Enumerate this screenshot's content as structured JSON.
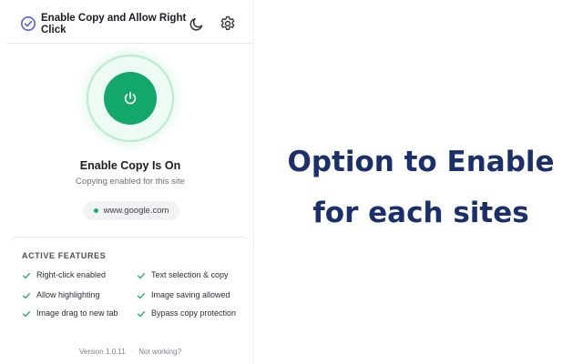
{
  "header": {
    "title": "Enable Copy and Allow Right Click",
    "icons": [
      "check-circle-icon",
      "moon-icon",
      "gear-icon"
    ]
  },
  "status": {
    "toggle_icon": "power-icon",
    "title": "Enable Copy Is On",
    "subtitle": "Copying enabled for this site",
    "site": "www.google.com"
  },
  "features": {
    "heading": "ACTIVE FEATURES",
    "items": [
      {
        "label": "Right-click enabled"
      },
      {
        "label": "Text selection & copy"
      },
      {
        "label": "Allow highlighting"
      },
      {
        "label": "Image saving allowed"
      },
      {
        "label": "Image drag to new tab"
      },
      {
        "label": "Bypass copy protection"
      }
    ]
  },
  "footer": {
    "version": "Version 1.0.11",
    "separator": "·",
    "help_link": "Not working?"
  },
  "caption": {
    "line1": "Option to Enable",
    "line2": "for each sites"
  },
  "colors": {
    "accent_green": "#12a86c",
    "caption_navy": "#1b2f6b"
  }
}
